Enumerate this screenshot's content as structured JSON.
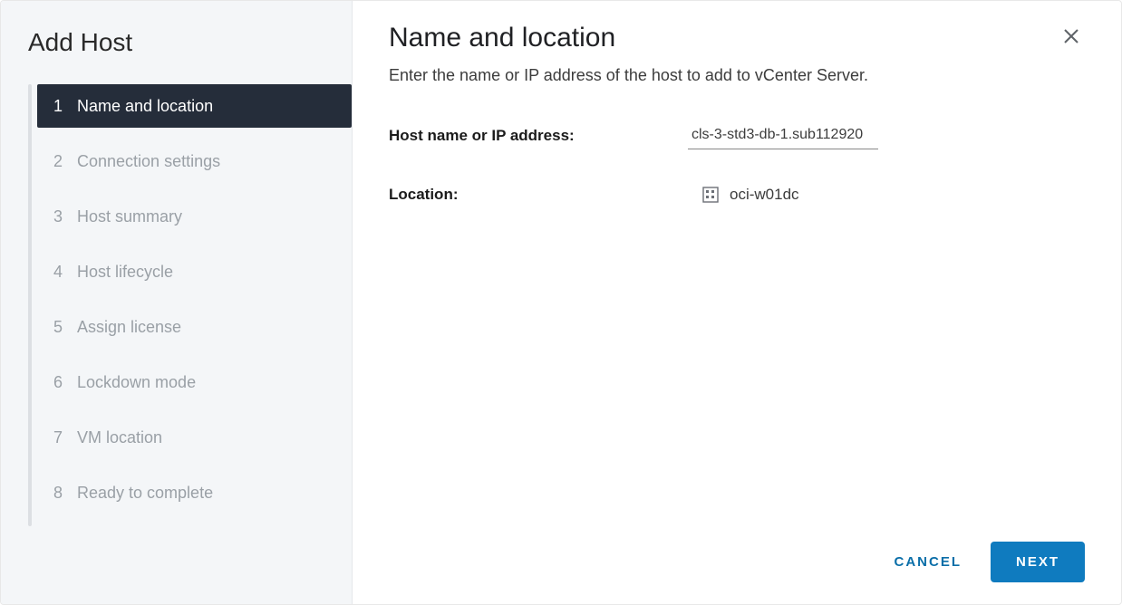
{
  "wizard": {
    "title": "Add Host",
    "steps": [
      {
        "num": "1",
        "label": "Name and location",
        "active": true
      },
      {
        "num": "2",
        "label": "Connection settings",
        "active": false
      },
      {
        "num": "3",
        "label": "Host summary",
        "active": false
      },
      {
        "num": "4",
        "label": "Host lifecycle",
        "active": false
      },
      {
        "num": "5",
        "label": "Assign license",
        "active": false
      },
      {
        "num": "6",
        "label": "Lockdown mode",
        "active": false
      },
      {
        "num": "7",
        "label": "VM location",
        "active": false
      },
      {
        "num": "8",
        "label": "Ready to complete",
        "active": false
      }
    ]
  },
  "page": {
    "title": "Name and location",
    "subtitle": "Enter the name or IP address of the host to add to vCenter Server.",
    "host_label": "Host name or IP address:",
    "host_value": "cls-3-std3-db-1.sub112920",
    "location_label": "Location:",
    "location_value": "oci-w01dc"
  },
  "buttons": {
    "cancel": "CANCEL",
    "next": "NEXT"
  }
}
